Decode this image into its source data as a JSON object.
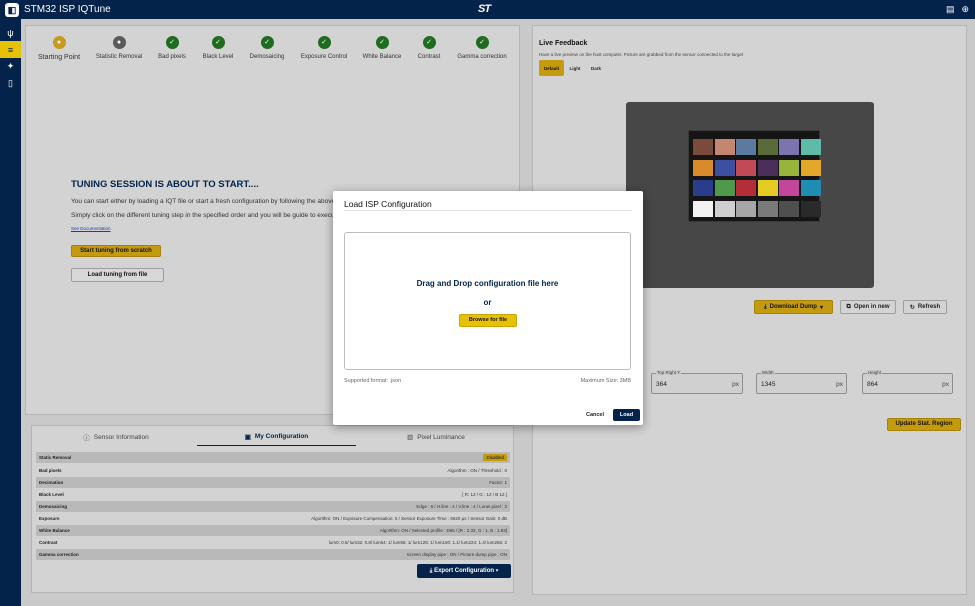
{
  "app": {
    "title": "STM32 ISP IQTune",
    "brand": "ST"
  },
  "topbar_icons": [
    "panel-icon",
    "globe-icon"
  ],
  "sidebar": [
    {
      "icon": "usb-icon",
      "active": false
    },
    {
      "icon": "tune-icon",
      "active": true
    },
    {
      "icon": "sensor-icon",
      "active": false
    },
    {
      "icon": "document-icon",
      "active": false
    }
  ],
  "stepper": [
    {
      "label": "Starting Point",
      "state": "current"
    },
    {
      "label": "Statistic Removal",
      "state": "pending"
    },
    {
      "label": "Bad pixels",
      "state": "done"
    },
    {
      "label": "Black Level",
      "state": "done"
    },
    {
      "label": "Demosaicing",
      "state": "done"
    },
    {
      "label": "Exposure Control",
      "state": "done"
    },
    {
      "label": "White Balance",
      "state": "done"
    },
    {
      "label": "Contrast",
      "state": "done"
    },
    {
      "label": "Gamma correction",
      "state": "done"
    }
  ],
  "tuning": {
    "title": "TUNING SESSION IS ABOUT TO START....",
    "line1": "You can start either by loading a IQT file or start a fresh configuration by following the above",
    "line2": "Simply click on the different tuning step in the specified order and you will be guide to execu",
    "doc_link": "See Documentation",
    "start_btn": "Start tuning from scratch",
    "load_btn": "Load tuning from file"
  },
  "tabs": [
    {
      "label": "Sensor Information",
      "icon": "info-icon",
      "active": false
    },
    {
      "label": "My Configuration",
      "icon": "config-icon",
      "active": true
    },
    {
      "label": "Pixel Luminance",
      "icon": "bar-chart-icon",
      "active": false
    }
  ],
  "config_rows": [
    {
      "key": "Static Removal",
      "value": "Disabled",
      "badge": true
    },
    {
      "key": "Bad pixels",
      "value": "Algorithm : ON / Threshold : 0"
    },
    {
      "key": "Decimation",
      "value": "Factor: 1"
    },
    {
      "key": "Black Level",
      "value": "[ R: 12 / G : 12 / B 12 ]"
    },
    {
      "key": "Demosaicing",
      "value": "Edge : 6 / H.line : 4 / V.line : 4 / Lonei pixel : 2"
    },
    {
      "key": "Exposure",
      "value": "Algorithm: ON / Exposure Compensation: 0 / Sensor Exposure Time : 6620 µs / Sensor Gain: 0 dB"
    },
    {
      "key": "White Balance",
      "value": "Algorithm: ON / Selected profile : D65 / [R : 2.32, G : 1, B : 1.83]"
    },
    {
      "key": "Contrast",
      "value": "lum0: 0.5/ lum32: 0.8/ lum64: 1/ lum96: 1/ lum128: 1/ lum160: 1.1/ lum224: 1.4/ lum256: 2"
    },
    {
      "key": "Gamma correction",
      "value": "Screen display pipe : ON / Picture dump pipe : ON"
    }
  ],
  "export_btn": "Export Configuration",
  "live": {
    "title": "Live Feedback",
    "subtitle": "Have a live preview on the host computer. Picture are grabbed from the sensor connected to the target",
    "modes": [
      "Default",
      "Light",
      "Dark"
    ],
    "active_mode": "Default"
  },
  "actions": {
    "download": "Download Dump",
    "open": "Open in new",
    "refresh": "Refresh"
  },
  "stat_region": {
    "fields": [
      {
        "label": "Top Right Y",
        "value": "364",
        "unit": "px"
      },
      {
        "label": "Width",
        "value": "1345",
        "unit": "px"
      },
      {
        "label": "Height",
        "value": "864",
        "unit": "px"
      }
    ],
    "update_btn": "Update Stat. Region"
  },
  "modal": {
    "title": "Load ISP Configuration",
    "drop_text": "Drag and Drop configuration file here",
    "or_text": "or",
    "browse_btn": "Browse for file",
    "format": "Supported format: .json",
    "max_size": "Maximum Size: 3MB",
    "cancel": "Cancel",
    "load": "Load"
  },
  "colors": {
    "navy": "#03234b",
    "yellow": "#e6c105",
    "done_green": "#1f6b1f"
  },
  "chart_patches": [
    "#7a4a3a",
    "#c48670",
    "#5b7aa0",
    "#5a6b3a",
    "#7c74ae",
    "#5fbaa8",
    "#d98a2a",
    "#3c4fa0",
    "#c24a56",
    "#4c2e5a",
    "#98b43a",
    "#e2a82a",
    "#2a3d8a",
    "#4f9a4a",
    "#b42e3a",
    "#e6cc22",
    "#c2469a",
    "#1f8cb4",
    "#f2f2f2",
    "#cfcfcf",
    "#a6a6a6",
    "#7a7a7a",
    "#4f4f4f",
    "#2a2a2a"
  ]
}
